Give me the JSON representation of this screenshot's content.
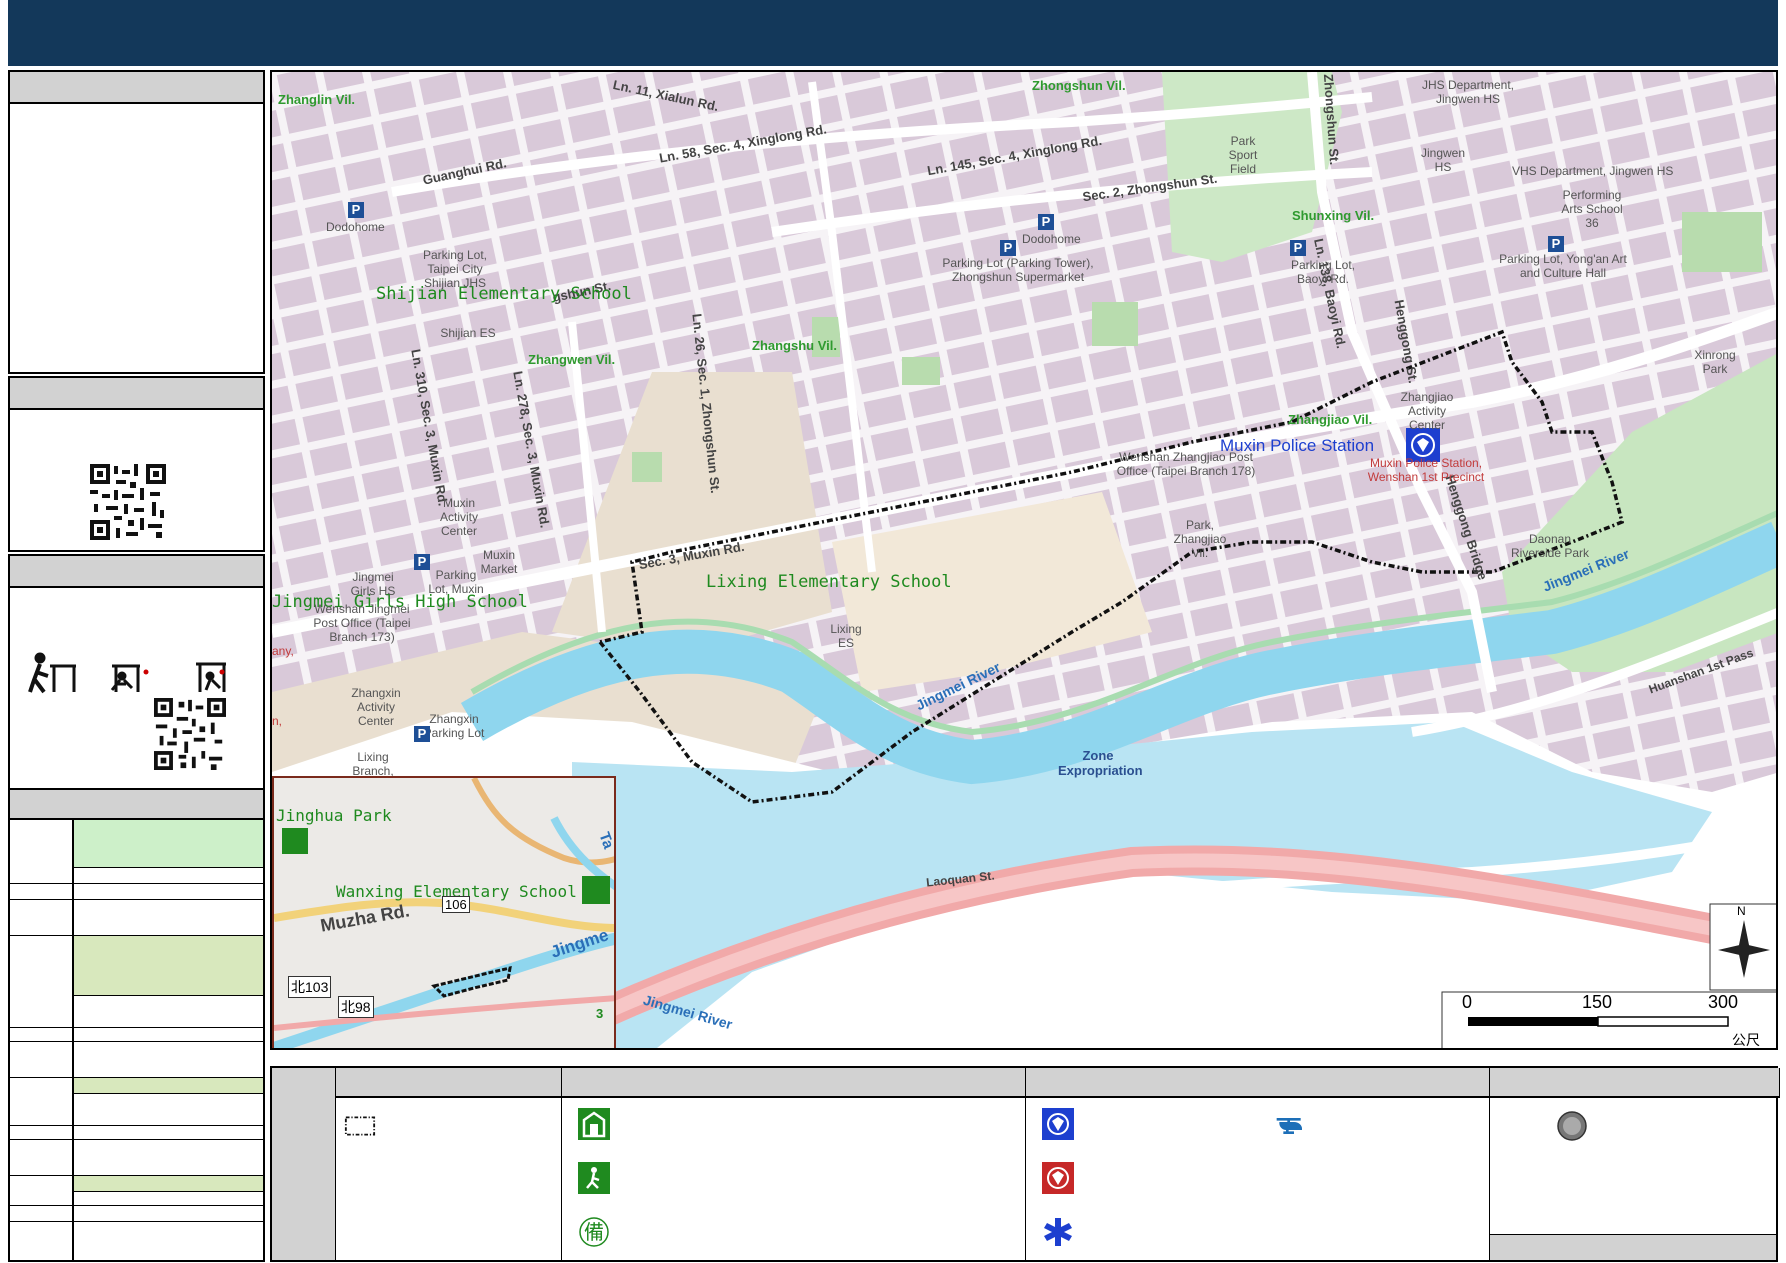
{
  "map": {
    "scale_bar": {
      "ticks": [
        "0",
        "150",
        "300"
      ],
      "unit": "公尺"
    },
    "north_label": "N",
    "shelters": [
      {
        "label": "Shijian Elementary School"
      },
      {
        "label": "Jingmei Girls High School"
      },
      {
        "label": "Lixing Elementary School"
      },
      {
        "label": "Muxin Police Station"
      }
    ],
    "villages": [
      "Zhanglin Vil.",
      "Zhongshun Vil.",
      "Shunxing Vil.",
      "Zhangshu Vil.",
      "Zhangwen Vil.",
      "Zhangjiao Vil."
    ],
    "roads": [
      "Ln. 11, Xialun Rd.",
      "Ln. 58, Sec. 4, Xinglong Rd.",
      "Ln. 145, Sec. 4, Xinglong Rd.",
      "Guanghui Rd.",
      "Sec. 2, Zhongshun St.",
      "Zhongshun St.",
      "Ln. 138, Baoyi Rd.",
      "Ln. 26, Sec. 1, Zhongshun St.",
      "Ln. 310, Sec. 3, Muxin Rd.",
      "Ln. 278, Sec. 3, Muxin Rd.",
      "Sec. 3, Muxin Rd.",
      "Henggong St.",
      "Henggong Bridge",
      "Jingmei River",
      "Jingmei River",
      "Jingmei River",
      "Huanshan 1st Pass",
      "Laoquan St.",
      "Zone Expropriation",
      "gshun St."
    ],
    "pois": [
      "Dodohome",
      "Dodohome",
      "Parking Lot, Taipei City Shijian JHS",
      "Shijian ES",
      "Parking Lot (Parking Tower), Zhongshun Supermarket",
      "Park Sport Field",
      "JHS Department, Jingwen HS",
      "Jingwen HS",
      "VHS Department, Jingwen HS",
      "Performing Arts School 36",
      "Parking Lot, Yong'an Art and Culture Hall",
      "Parking Lot, Baoyi Rd.",
      "Xinrong Park",
      "Zhangjiao Activity Center",
      "Muxin Police Station, Wenshan 1st Precinct",
      "Wenshan Zhangjiao Post Office (Taipei Branch 178)",
      "Park, Zhangjiao Vil.",
      "Daonan Riverside Park",
      "Muxin Activity Center",
      "Muxin Market",
      "Parking Lot, Muxin",
      "Jingmei Girls HS",
      "Wenshan Jingmei Post Office (Taipei Branch 173)",
      "Lixing ES",
      "Zhangxin Activity Center",
      "Zhangxin Parking Lot",
      "Lixing Branch, Taipei",
      "any,",
      "n,"
    ]
  },
  "inset": {
    "labels": [
      "Jinghua Park",
      "Wanxing Elementary School",
      "Muzha Rd.",
      "106",
      "北103",
      "北98",
      "Jingme",
      "Ta",
      "3"
    ]
  },
  "legend": {},
  "colors": {
    "header": "#13385a",
    "water": "#a6dcef",
    "green": "#c8e6c0",
    "blocks": "#d9c9d9",
    "road_highway": "#f1a9a9",
    "shelter_green": "#1f8a1f",
    "police_blue": "#1d3fcf"
  }
}
